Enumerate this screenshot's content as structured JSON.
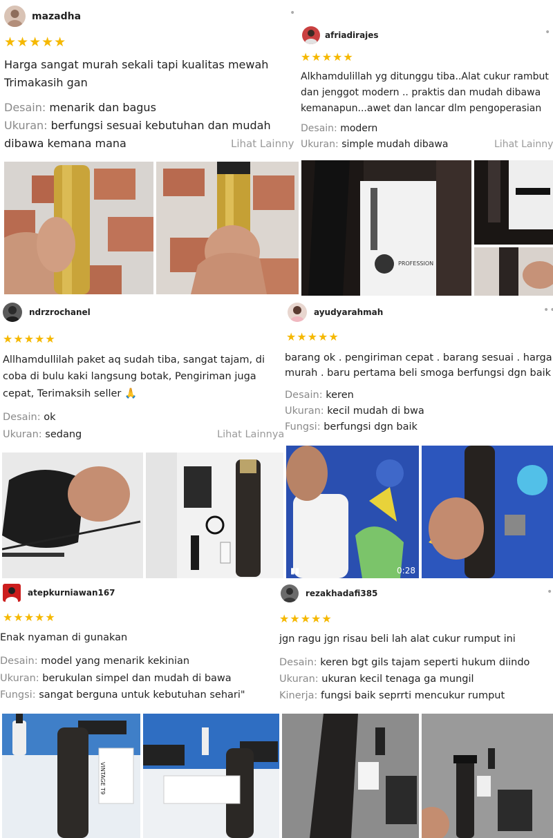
{
  "reviews": [
    {
      "username": "mazadha",
      "stars": "★★★★★",
      "comment_lines": [
        "Harga sangat murah sekali tapi kualitas mewah",
        "Trimakasih gan"
      ],
      "attributes": [
        {
          "key": "Desain:",
          "value": "menarik dan bagus"
        },
        {
          "key": "Ukuran:",
          "value": "berfungsi sesuai kebutuhan dan mudah"
        }
      ],
      "continuation": "dibawa kemana mana",
      "see_more": "Lihat Lainnya"
    },
    {
      "username": "afriadirajes",
      "stars": "★★★★★",
      "comment_lines": [
        "Alkhamdulillah yg ditunggu tiba..Alat cukur rambut",
        "dan jenggot modern .. praktis dan mudah dibawa",
        "kemanapun...awet dan lancar dlm pengoperasian"
      ],
      "attributes": [
        {
          "key": "Desain:",
          "value": "modern"
        },
        {
          "key": "Ukuran:",
          "value": "simple mudah dibawa"
        }
      ],
      "see_more": "Lihat Lainnya"
    },
    {
      "username": "ndrzrochanel",
      "stars": "★★★★★",
      "comment_lines": [
        "Allhamdullilah paket aq sudah tiba, sangat tajam, di",
        "coba di bulu kaki langsung botak, Pengiriman juga",
        "cepat, Terimaksih seller 🙏"
      ],
      "attributes": [
        {
          "key": "Desain:",
          "value": "ok"
        },
        {
          "key": "Ukuran:",
          "value": "sedang"
        }
      ],
      "see_more": "Lihat Lainnya"
    },
    {
      "username": "ayudyarahmah",
      "stars": "★★★★★",
      "comment_lines": [
        "barang ok . pengiriman cepat . barang sesuai . harga",
        "murah . baru pertama beli smoga berfungsi dgn baik"
      ],
      "attributes": [
        {
          "key": "Desain:",
          "value": "keren"
        },
        {
          "key": "Ukuran:",
          "value": "kecil mudah di bwa"
        },
        {
          "key": "Fungsi:",
          "value": "berfungsi dgn baik"
        }
      ],
      "video_duration": "0:28"
    },
    {
      "username": "atepkurniawan167",
      "stars": "★★★★★",
      "comment_lines": [
        "Enak nyaman di gunakan"
      ],
      "attributes": [
        {
          "key": "Desain:",
          "value": "model yang menarik kekinian"
        },
        {
          "key": "Ukuran:",
          "value": "berukulan simpel dan mudah di bawa"
        },
        {
          "key": "Fungsi:",
          "value": "sangat berguna untuk kebutuhan sehari\""
        }
      ]
    },
    {
      "username": "rezakhadafi385",
      "stars": "★★★★★",
      "comment_lines": [
        "jgn ragu jgn risau beli lah alat cukur rumput ini"
      ],
      "attributes": [
        {
          "key": "Desain:",
          "value": "keren bgt gils tajam seperti hukum diindo"
        },
        {
          "key": "Ukuran:",
          "value": "ukuran kecil tenaga ga mungil"
        },
        {
          "key": "Kinerja:",
          "value": "fungsi baik seprrti mencukur rumput"
        }
      ]
    }
  ],
  "icons": {
    "more": "more-dots-icon",
    "video": "video-indicator-icon"
  },
  "photo_labels": {
    "vintage": "VINTAGE T9",
    "profession": "PROFESSION"
  },
  "colors": {
    "star": "#f5b800",
    "attr_key": "#8a8a8a",
    "see_more": "#9a9a9a"
  }
}
